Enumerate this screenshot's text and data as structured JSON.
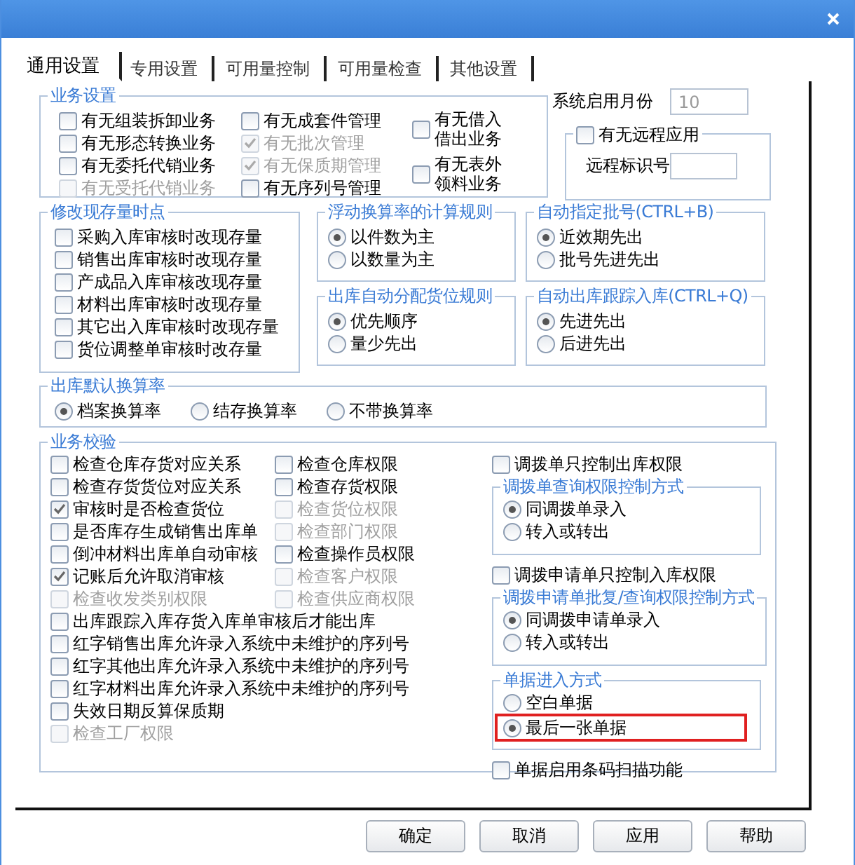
{
  "tabs": [
    {
      "label": "通用设置",
      "selected": true
    },
    {
      "label": "专用设置",
      "selected": false
    },
    {
      "label": "可用量控制",
      "selected": false
    },
    {
      "label": "可用量检查",
      "selected": false
    },
    {
      "label": "其他设置",
      "selected": false
    }
  ],
  "business_settings": {
    "title": "业务设置",
    "columns": [
      [
        {
          "label": "有无组装拆卸业务",
          "checked": false,
          "disabled": false
        },
        {
          "label": "有无形态转换业务",
          "checked": false,
          "disabled": false
        },
        {
          "label": "有无委托代销业务",
          "checked": false,
          "disabled": false
        },
        {
          "label": "有无受托代销业务",
          "checked": false,
          "disabled": true
        }
      ],
      [
        {
          "label": "有无成套件管理",
          "checked": false,
          "disabled": false
        },
        {
          "label": "有无批次管理",
          "checked": true,
          "disabled": true
        },
        {
          "label": "有无保质期管理",
          "checked": true,
          "disabled": true
        },
        {
          "label": "有无序列号管理",
          "checked": false,
          "disabled": false
        }
      ],
      [
        {
          "label": "有无借入借出业务",
          "checked": false,
          "disabled": false
        },
        {
          "label": "有无表外领料业务",
          "checked": false,
          "disabled": false
        }
      ]
    ]
  },
  "system_month": {
    "label": "系统启用月份",
    "value": "10",
    "disabled": true
  },
  "remote": {
    "label": "有无远程应用",
    "checked": false,
    "disabled": false,
    "id_label": "远程标识号"
  },
  "stock_update": {
    "title": "修改现存量时点",
    "options": [
      {
        "label": "采购入库审核时改现存量",
        "checked": false,
        "disabled": false
      },
      {
        "label": "销售出库审核时改现存量",
        "checked": false,
        "disabled": false
      },
      {
        "label": "产成品入库审核改现存量",
        "checked": false,
        "disabled": false
      },
      {
        "label": "材料出库审核时改现存量",
        "checked": false,
        "disabled": false
      },
      {
        "label": "其它出入库审核时改现存量",
        "checked": false,
        "disabled": false
      },
      {
        "label": "货位调整单审核时改存量",
        "checked": false,
        "disabled": false
      }
    ]
  },
  "float_rate": {
    "title": "浮动换算率的计算规则",
    "options": [
      {
        "label": "以件数为主",
        "selected": true
      },
      {
        "label": "以数量为主",
        "selected": false
      }
    ]
  },
  "auto_location": {
    "title": "出库自动分配货位规则",
    "options": [
      {
        "label": "优先顺序",
        "selected": true
      },
      {
        "label": "量少先出",
        "selected": false
      }
    ]
  },
  "auto_batch": {
    "title": "自动指定批号(CTRL+B)",
    "options": [
      {
        "label": "近效期先出",
        "selected": true
      },
      {
        "label": "批号先进先出",
        "selected": false
      }
    ]
  },
  "auto_track": {
    "title": "自动出库跟踪入库(CTRL+Q)",
    "options": [
      {
        "label": "先进先出",
        "selected": true
      },
      {
        "label": "后进先出",
        "selected": false
      }
    ]
  },
  "default_rate": {
    "title": "出库默认换算率",
    "options": [
      {
        "label": "档案换算率",
        "selected": true
      },
      {
        "label": "结存换算率",
        "selected": false
      },
      {
        "label": "不带换算率",
        "selected": false
      }
    ]
  },
  "verification": {
    "title": "业务校验",
    "left": [
      {
        "label": "检查仓库存货对应关系",
        "checked": false,
        "disabled": false
      },
      {
        "label": "检查存货货位对应关系",
        "checked": false,
        "disabled": false
      },
      {
        "label": "审核时是否检查货位",
        "checked": true,
        "disabled": false
      },
      {
        "label": "是否库存生成销售出库单",
        "checked": false,
        "disabled": false
      },
      {
        "label": "倒冲材料出库单自动审核",
        "checked": false,
        "disabled": false
      },
      {
        "label": "记账后允许取消审核",
        "checked": true,
        "disabled": false
      },
      {
        "label": "检查收发类别权限",
        "checked": false,
        "disabled": true
      }
    ],
    "right": [
      {
        "label": "检查仓库权限",
        "checked": false,
        "disabled": false
      },
      {
        "label": "检查存货权限",
        "checked": false,
        "disabled": false
      },
      {
        "label": "检查货位权限",
        "checked": false,
        "disabled": true
      },
      {
        "label": "检查部门权限",
        "checked": false,
        "disabled": true
      },
      {
        "label": "检查操作员权限",
        "checked": false,
        "disabled": false
      },
      {
        "label": "检查客户权限",
        "checked": false,
        "disabled": true
      },
      {
        "label": "检查供应商权限",
        "checked": false,
        "disabled": true
      }
    ],
    "wide": [
      {
        "label": "出库跟踪入库存货入库单审核后才能出库",
        "checked": false,
        "disabled": false
      },
      {
        "label": "红字销售出库允许录入系统中未维护的序列号",
        "checked": false,
        "disabled": false
      },
      {
        "label": "红字其他出库允许录入系统中未维护的序列号",
        "checked": false,
        "disabled": false
      },
      {
        "label": "红字材料出库允许录入系统中未维护的序列号",
        "checked": false,
        "disabled": false
      },
      {
        "label": "失效日期反算保质期",
        "checked": false,
        "disabled": false
      },
      {
        "label": "检查工厂权限",
        "checked": false,
        "disabled": true
      }
    ],
    "side": [
      {
        "kind": "check",
        "label": "调拨单只控制出库权限",
        "checked": false,
        "disabled": false
      },
      {
        "kind": "group",
        "title": "调拨单查询权限控制方式",
        "options": [
          {
            "label": "同调拨单录入",
            "selected": true
          },
          {
            "label": "转入或转出",
            "selected": false
          }
        ]
      },
      {
        "kind": "check",
        "label": "调拨申请单只控制入库权限",
        "checked": false,
        "disabled": false
      },
      {
        "kind": "group",
        "title": "调拨申请单批复/查询权限控制方式",
        "options": [
          {
            "label": "同调拨申请单录入",
            "selected": true
          },
          {
            "label": "转入或转出",
            "selected": false
          }
        ]
      },
      {
        "kind": "group",
        "title": "单据进入方式",
        "options": [
          {
            "label": "空白单据",
            "selected": false,
            "highlighted": false
          },
          {
            "label": "最后一张单据",
            "selected": true,
            "highlighted": true
          }
        ]
      },
      {
        "kind": "check",
        "label": "单据启用条码扫描功能",
        "checked": false,
        "disabled": false
      }
    ]
  },
  "buttons": [
    "确定",
    "取消",
    "应用",
    "帮助"
  ]
}
